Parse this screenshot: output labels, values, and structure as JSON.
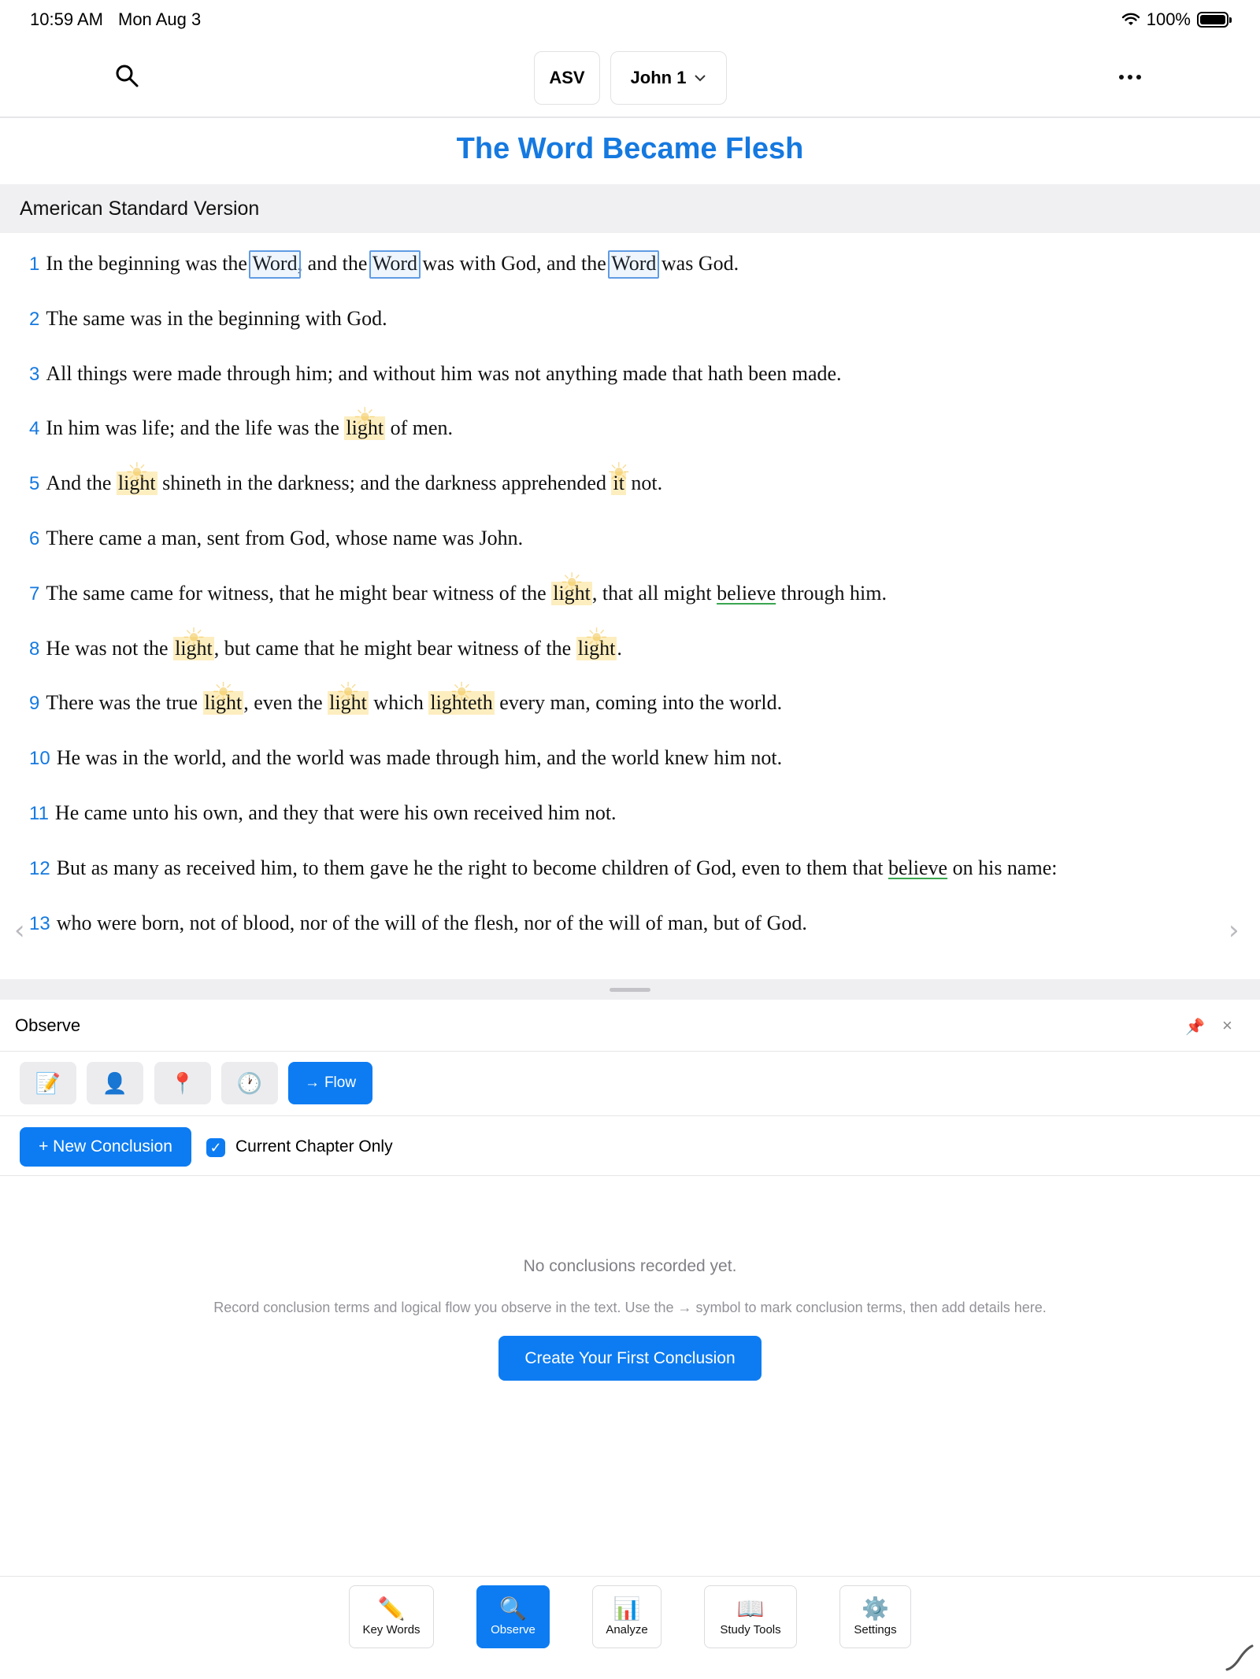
{
  "status": {
    "time": "10:59 AM",
    "date": "Mon Aug 3",
    "battery": "100%"
  },
  "topnav": {
    "version": "ASV",
    "chapter": "John 1"
  },
  "heading": "The Word Became Flesh",
  "version_name": "American Standard Version",
  "verses": [
    {
      "n": "1",
      "parts": [
        {
          "t": "In the beginning was the "
        },
        {
          "t": "Word",
          "mark": "word"
        },
        {
          "t": ", and the "
        },
        {
          "t": "Word",
          "mark": "word"
        },
        {
          "t": " was with God, and the "
        },
        {
          "t": "Word",
          "mark": "word"
        },
        {
          "t": " was God."
        }
      ]
    },
    {
      "n": "2",
      "parts": [
        {
          "t": "The same was in the beginning with God."
        }
      ]
    },
    {
      "n": "3",
      "parts": [
        {
          "t": "All things were made through him; and without him was not anything made that hath been made."
        }
      ]
    },
    {
      "n": "4",
      "parts": [
        {
          "t": "In him was life; and the life was the "
        },
        {
          "t": "light",
          "mark": "light"
        },
        {
          "t": " of men."
        }
      ]
    },
    {
      "n": "5",
      "parts": [
        {
          "t": "And the "
        },
        {
          "t": "light",
          "mark": "light"
        },
        {
          "t": " shineth in the darkness; and the darkness apprehended "
        },
        {
          "t": "it",
          "mark": "light"
        },
        {
          "t": " not."
        }
      ]
    },
    {
      "n": "6",
      "parts": [
        {
          "t": "There came a man, sent from God, whose name was John."
        }
      ]
    },
    {
      "n": "7",
      "parts": [
        {
          "t": "The same came for witness, that he might bear witness of the "
        },
        {
          "t": "light",
          "mark": "light"
        },
        {
          "t": ", that all might "
        },
        {
          "t": "believe",
          "mark": "believe"
        },
        {
          "t": " through him."
        }
      ]
    },
    {
      "n": "8",
      "parts": [
        {
          "t": "He was not the "
        },
        {
          "t": "light",
          "mark": "light"
        },
        {
          "t": ", but came that he might bear witness of the "
        },
        {
          "t": "light",
          "mark": "light"
        },
        {
          "t": "."
        }
      ]
    },
    {
      "n": "9",
      "parts": [
        {
          "t": "There was the true "
        },
        {
          "t": "light",
          "mark": "light"
        },
        {
          "t": ", even the "
        },
        {
          "t": "light",
          "mark": "light"
        },
        {
          "t": " which "
        },
        {
          "t": "lighteth",
          "mark": "light"
        },
        {
          "t": " every man, coming into the world."
        }
      ]
    },
    {
      "n": "10",
      "parts": [
        {
          "t": "He was in the world, and the world was made through him, and the world knew him not."
        }
      ]
    },
    {
      "n": "11",
      "parts": [
        {
          "t": "He came unto his own, and they that were his own received him not."
        }
      ]
    },
    {
      "n": "12",
      "parts": [
        {
          "t": "But as many as received him, to them gave he the right to become children of God, even to them that "
        },
        {
          "t": "believe",
          "mark": "believe"
        },
        {
          "t": " on his name:"
        }
      ]
    },
    {
      "n": "13",
      "parts": [
        {
          "t": "who were born, not of blood, nor of the will of the flesh, nor of the will of man, but of God."
        }
      ]
    }
  ],
  "panel": {
    "title": "Observe",
    "tools": [
      {
        "icon": "memo-icon",
        "glyph": "📝"
      },
      {
        "icon": "person-icon",
        "glyph": "👤"
      },
      {
        "icon": "pushpin-icon",
        "glyph": "📍"
      },
      {
        "icon": "clock-icon",
        "glyph": "🕐"
      }
    ],
    "flow_label": "Flow",
    "new_conclusion": "+ New Conclusion",
    "current_chapter_only": "Current Chapter Only",
    "current_chapter_checked": true,
    "empty_title": "No conclusions recorded yet.",
    "empty_desc": "Record conclusion terms and logical flow you observe in the text. Use the → symbol to mark conclusion terms, then add details here.",
    "create_first": "Create Your First Conclusion"
  },
  "tabs": [
    {
      "label": "Key Words",
      "icon": "pencil-icon",
      "glyph": "✏️",
      "active": false
    },
    {
      "label": "Observe",
      "icon": "magnifier-icon",
      "glyph": "🔍",
      "active": true
    },
    {
      "label": "Analyze",
      "icon": "bar-chart-icon",
      "glyph": "📊",
      "active": false
    },
    {
      "label": "Study Tools",
      "icon": "book-icon",
      "glyph": "📖",
      "active": false
    },
    {
      "label": "Settings",
      "icon": "gear-icon",
      "glyph": "⚙️",
      "active": false
    }
  ],
  "colors": {
    "accent": "#0d7cf2",
    "heading": "#1579e0",
    "light_highlight": "#fdeec0",
    "believe_underline": "#3aa650",
    "word_box": "#5f9be4"
  }
}
